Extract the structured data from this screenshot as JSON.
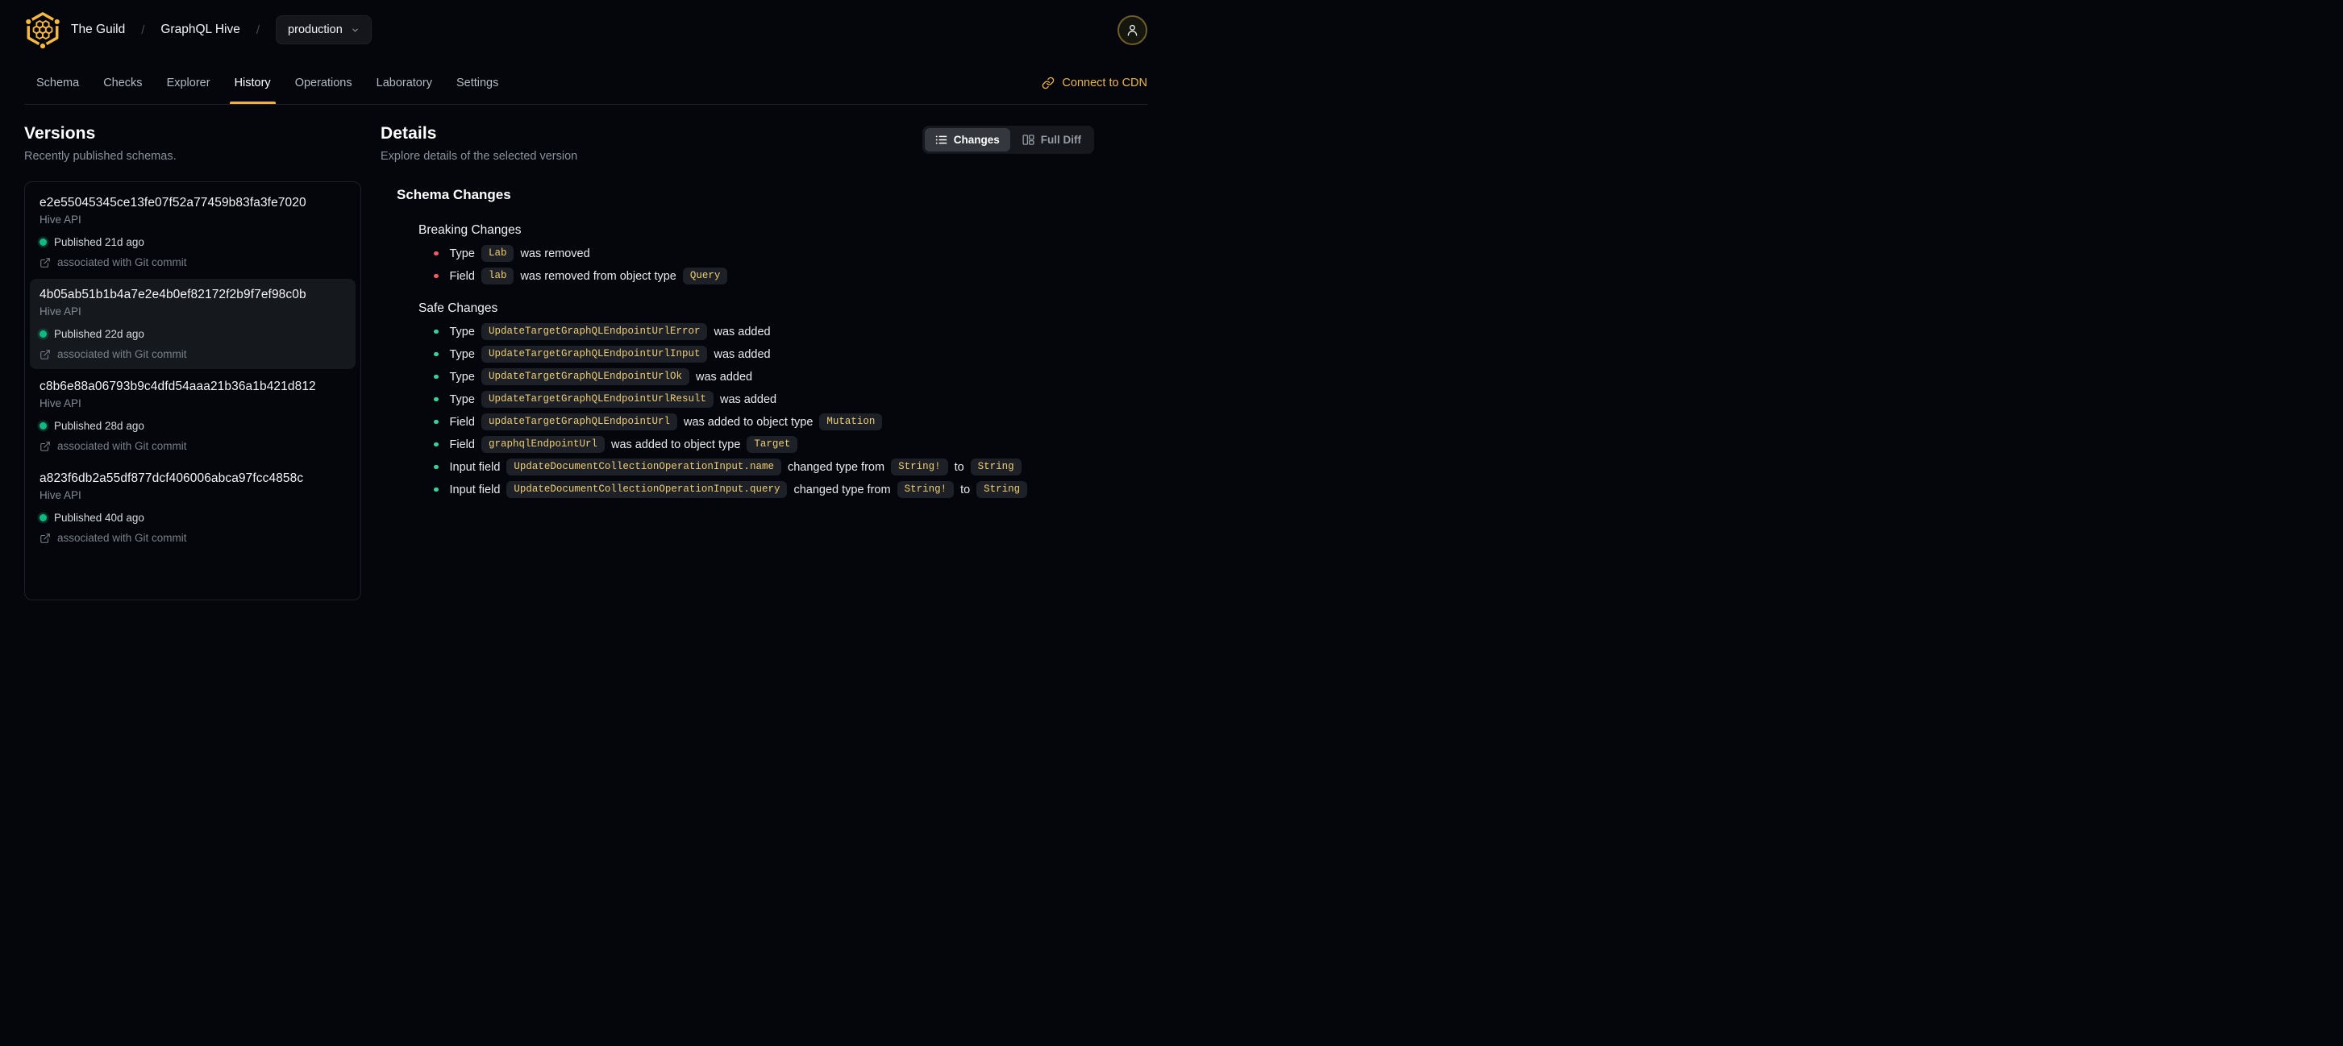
{
  "header": {
    "org": "The Guild",
    "separator": "/",
    "project": "GraphQL Hive",
    "target_selector": "production",
    "tabs": [
      "Schema",
      "Checks",
      "Explorer",
      "History",
      "Operations",
      "Laboratory",
      "Settings"
    ],
    "active_tab": "History",
    "connect_cdn_label": "Connect to CDN"
  },
  "versions": {
    "title": "Versions",
    "subtitle": "Recently published schemas.",
    "items": [
      {
        "hash": "e2e55045345ce13fe07f52a77459b83fa3fe7020",
        "service": "Hive API",
        "published": "Published 21d ago",
        "git": "associated with Git commit",
        "selected": false
      },
      {
        "hash": "4b05ab51b1b4a7e2e4b0ef82172f2b9f7ef98c0b",
        "service": "Hive API",
        "published": "Published 22d ago",
        "git": "associated with Git commit",
        "selected": true
      },
      {
        "hash": "c8b6e88a06793b9c4dfd54aaa21b36a1b421d812",
        "service": "Hive API",
        "published": "Published 28d ago",
        "git": "associated with Git commit",
        "selected": false
      },
      {
        "hash": "a823f6db2a55df877dcf406006abca97fcc4858c",
        "service": "Hive API",
        "published": "Published 40d ago",
        "git": "associated with Git commit",
        "selected": false
      }
    ]
  },
  "details": {
    "title": "Details",
    "subtitle": "Explore details of the selected version",
    "view_toggle": {
      "changes_label": "Changes",
      "full_diff_label": "Full Diff"
    },
    "schema_changes_title": "Schema Changes",
    "breaking": {
      "title": "Breaking Changes",
      "items": [
        [
          {
            "type": "text",
            "value": "Type"
          },
          {
            "type": "code",
            "value": "Lab"
          },
          {
            "type": "text",
            "value": "was removed"
          }
        ],
        [
          {
            "type": "text",
            "value": "Field"
          },
          {
            "type": "code",
            "value": "lab"
          },
          {
            "type": "text",
            "value": "was removed from object type"
          },
          {
            "type": "code",
            "value": "Query"
          }
        ]
      ]
    },
    "safe": {
      "title": "Safe Changes",
      "items": [
        [
          {
            "type": "text",
            "value": "Type"
          },
          {
            "type": "code",
            "value": "UpdateTargetGraphQLEndpointUrlError"
          },
          {
            "type": "text",
            "value": "was added"
          }
        ],
        [
          {
            "type": "text",
            "value": "Type"
          },
          {
            "type": "code",
            "value": "UpdateTargetGraphQLEndpointUrlInput"
          },
          {
            "type": "text",
            "value": "was added"
          }
        ],
        [
          {
            "type": "text",
            "value": "Type"
          },
          {
            "type": "code",
            "value": "UpdateTargetGraphQLEndpointUrlOk"
          },
          {
            "type": "text",
            "value": "was added"
          }
        ],
        [
          {
            "type": "text",
            "value": "Type"
          },
          {
            "type": "code",
            "value": "UpdateTargetGraphQLEndpointUrlResult"
          },
          {
            "type": "text",
            "value": "was added"
          }
        ],
        [
          {
            "type": "text",
            "value": "Field"
          },
          {
            "type": "code",
            "value": "updateTargetGraphQLEndpointUrl"
          },
          {
            "type": "text",
            "value": "was added to object type"
          },
          {
            "type": "code",
            "value": "Mutation"
          }
        ],
        [
          {
            "type": "text",
            "value": "Field"
          },
          {
            "type": "code",
            "value": "graphqlEndpointUrl"
          },
          {
            "type": "text",
            "value": "was added to object type"
          },
          {
            "type": "code",
            "value": "Target"
          }
        ],
        [
          {
            "type": "text",
            "value": "Input field"
          },
          {
            "type": "code",
            "value": "UpdateDocumentCollectionOperationInput.name"
          },
          {
            "type": "text",
            "value": "changed type from"
          },
          {
            "type": "code",
            "value": "String!"
          },
          {
            "type": "text",
            "value": "to"
          },
          {
            "type": "code",
            "value": "String"
          }
        ],
        [
          {
            "type": "text",
            "value": "Input field"
          },
          {
            "type": "code",
            "value": "UpdateDocumentCollectionOperationInput.query"
          },
          {
            "type": "text",
            "value": "changed type from"
          },
          {
            "type": "code",
            "value": "String!"
          },
          {
            "type": "text",
            "value": "to"
          },
          {
            "type": "code",
            "value": "String"
          }
        ]
      ]
    }
  },
  "colors": {
    "accent": "#f2b13c",
    "accent_text": "#f1b53d",
    "code_text": "#eecd72",
    "code_bg": "#1d2027",
    "breaking_bullet": "#ef5b66",
    "safe_bullet": "#34d399",
    "published_dot": "#10b981",
    "page_bg": "#04060c"
  },
  "icons": {
    "logo": "hive-honeycomb-logo",
    "dropdown": "chevron-down-icon",
    "user": "person-icon",
    "cdn": "link-icon",
    "changes": "list-icon",
    "full_diff": "split-columns-icon",
    "git": "external-link-icon"
  }
}
